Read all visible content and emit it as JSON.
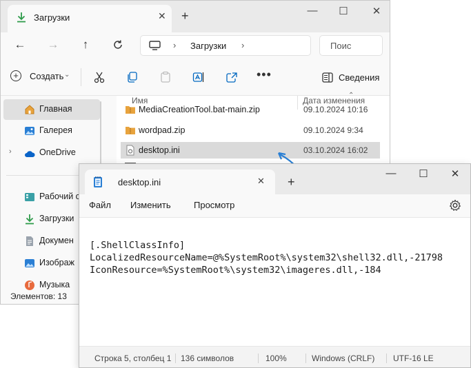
{
  "explorer": {
    "tab": {
      "title": "Загрузки"
    },
    "address": {
      "crumb": "Загрузки"
    },
    "search": {
      "placeholder": "Поис"
    },
    "toolbar": {
      "create_label": "Создать",
      "details_label": "Сведения"
    },
    "sidebar": {
      "items": [
        {
          "label": "Главная",
          "icon": "home-icon"
        },
        {
          "label": "Галерея",
          "icon": "gallery-icon"
        },
        {
          "label": "OneDrive",
          "icon": "cloud-icon"
        },
        {
          "label": "Рабочий с",
          "icon": "desktop-icon"
        },
        {
          "label": "Загрузки",
          "icon": "download-icon"
        },
        {
          "label": "Докумен",
          "icon": "document-icon"
        },
        {
          "label": "Изображ",
          "icon": "pictures-icon"
        },
        {
          "label": "Музыка",
          "icon": "music-icon"
        }
      ]
    },
    "columns": {
      "name": "Имя",
      "date": "Дата изменения"
    },
    "files": [
      {
        "name": "MediaCreationTool.bat-main.zip",
        "date": "09.10.2024 10:16",
        "icon": "zip-folder-icon"
      },
      {
        "name": "wordpad.zip",
        "date": "09.10.2024 9:34",
        "icon": "zip-folder-icon"
      },
      {
        "name": "desktop.ini",
        "date": "03.10.2024 16:02",
        "icon": "settings-file-icon"
      }
    ],
    "status": "Элементов: 13"
  },
  "notepad": {
    "tab": {
      "title": "desktop.ini"
    },
    "menu": {
      "file": "Файл",
      "edit": "Изменить",
      "view": "Просмотр"
    },
    "content": [
      "[.ShellClassInfo]",
      "LocalizedResourceName=@%SystemRoot%\\system32\\shell32.dll,-21798",
      "IconResource=%SystemRoot%\\system32\\imageres.dll,-184"
    ],
    "status": {
      "position": "Строка 5, столбец 1",
      "chars": "136 символов",
      "zoom": "100%",
      "line_ending": "Windows (CRLF)",
      "encoding": "UTF-16 LE"
    }
  },
  "colors": {
    "accent": "#0067c0",
    "selection": "#dadada",
    "download_green": "#2e9b4a",
    "folder": "#e8a33d"
  }
}
